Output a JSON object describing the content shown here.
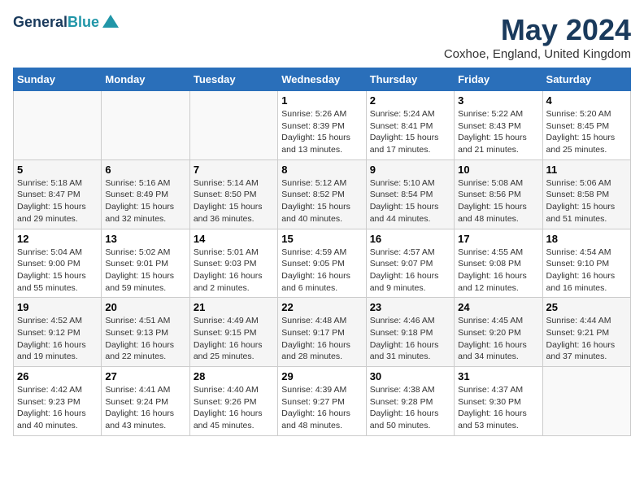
{
  "header": {
    "logo_line1": "General",
    "logo_line2": "Blue",
    "month": "May 2024",
    "location": "Coxhoe, England, United Kingdom"
  },
  "columns": [
    "Sunday",
    "Monday",
    "Tuesday",
    "Wednesday",
    "Thursday",
    "Friday",
    "Saturday"
  ],
  "weeks": [
    [
      {
        "day": "",
        "info": ""
      },
      {
        "day": "",
        "info": ""
      },
      {
        "day": "",
        "info": ""
      },
      {
        "day": "1",
        "info": "Sunrise: 5:26 AM\nSunset: 8:39 PM\nDaylight: 15 hours\nand 13 minutes."
      },
      {
        "day": "2",
        "info": "Sunrise: 5:24 AM\nSunset: 8:41 PM\nDaylight: 15 hours\nand 17 minutes."
      },
      {
        "day": "3",
        "info": "Sunrise: 5:22 AM\nSunset: 8:43 PM\nDaylight: 15 hours\nand 21 minutes."
      },
      {
        "day": "4",
        "info": "Sunrise: 5:20 AM\nSunset: 8:45 PM\nDaylight: 15 hours\nand 25 minutes."
      }
    ],
    [
      {
        "day": "5",
        "info": "Sunrise: 5:18 AM\nSunset: 8:47 PM\nDaylight: 15 hours\nand 29 minutes."
      },
      {
        "day": "6",
        "info": "Sunrise: 5:16 AM\nSunset: 8:49 PM\nDaylight: 15 hours\nand 32 minutes."
      },
      {
        "day": "7",
        "info": "Sunrise: 5:14 AM\nSunset: 8:50 PM\nDaylight: 15 hours\nand 36 minutes."
      },
      {
        "day": "8",
        "info": "Sunrise: 5:12 AM\nSunset: 8:52 PM\nDaylight: 15 hours\nand 40 minutes."
      },
      {
        "day": "9",
        "info": "Sunrise: 5:10 AM\nSunset: 8:54 PM\nDaylight: 15 hours\nand 44 minutes."
      },
      {
        "day": "10",
        "info": "Sunrise: 5:08 AM\nSunset: 8:56 PM\nDaylight: 15 hours\nand 48 minutes."
      },
      {
        "day": "11",
        "info": "Sunrise: 5:06 AM\nSunset: 8:58 PM\nDaylight: 15 hours\nand 51 minutes."
      }
    ],
    [
      {
        "day": "12",
        "info": "Sunrise: 5:04 AM\nSunset: 9:00 PM\nDaylight: 15 hours\nand 55 minutes."
      },
      {
        "day": "13",
        "info": "Sunrise: 5:02 AM\nSunset: 9:01 PM\nDaylight: 15 hours\nand 59 minutes."
      },
      {
        "day": "14",
        "info": "Sunrise: 5:01 AM\nSunset: 9:03 PM\nDaylight: 16 hours\nand 2 minutes."
      },
      {
        "day": "15",
        "info": "Sunrise: 4:59 AM\nSunset: 9:05 PM\nDaylight: 16 hours\nand 6 minutes."
      },
      {
        "day": "16",
        "info": "Sunrise: 4:57 AM\nSunset: 9:07 PM\nDaylight: 16 hours\nand 9 minutes."
      },
      {
        "day": "17",
        "info": "Sunrise: 4:55 AM\nSunset: 9:08 PM\nDaylight: 16 hours\nand 12 minutes."
      },
      {
        "day": "18",
        "info": "Sunrise: 4:54 AM\nSunset: 9:10 PM\nDaylight: 16 hours\nand 16 minutes."
      }
    ],
    [
      {
        "day": "19",
        "info": "Sunrise: 4:52 AM\nSunset: 9:12 PM\nDaylight: 16 hours\nand 19 minutes."
      },
      {
        "day": "20",
        "info": "Sunrise: 4:51 AM\nSunset: 9:13 PM\nDaylight: 16 hours\nand 22 minutes."
      },
      {
        "day": "21",
        "info": "Sunrise: 4:49 AM\nSunset: 9:15 PM\nDaylight: 16 hours\nand 25 minutes."
      },
      {
        "day": "22",
        "info": "Sunrise: 4:48 AM\nSunset: 9:17 PM\nDaylight: 16 hours\nand 28 minutes."
      },
      {
        "day": "23",
        "info": "Sunrise: 4:46 AM\nSunset: 9:18 PM\nDaylight: 16 hours\nand 31 minutes."
      },
      {
        "day": "24",
        "info": "Sunrise: 4:45 AM\nSunset: 9:20 PM\nDaylight: 16 hours\nand 34 minutes."
      },
      {
        "day": "25",
        "info": "Sunrise: 4:44 AM\nSunset: 9:21 PM\nDaylight: 16 hours\nand 37 minutes."
      }
    ],
    [
      {
        "day": "26",
        "info": "Sunrise: 4:42 AM\nSunset: 9:23 PM\nDaylight: 16 hours\nand 40 minutes."
      },
      {
        "day": "27",
        "info": "Sunrise: 4:41 AM\nSunset: 9:24 PM\nDaylight: 16 hours\nand 43 minutes."
      },
      {
        "day": "28",
        "info": "Sunrise: 4:40 AM\nSunset: 9:26 PM\nDaylight: 16 hours\nand 45 minutes."
      },
      {
        "day": "29",
        "info": "Sunrise: 4:39 AM\nSunset: 9:27 PM\nDaylight: 16 hours\nand 48 minutes."
      },
      {
        "day": "30",
        "info": "Sunrise: 4:38 AM\nSunset: 9:28 PM\nDaylight: 16 hours\nand 50 minutes."
      },
      {
        "day": "31",
        "info": "Sunrise: 4:37 AM\nSunset: 9:30 PM\nDaylight: 16 hours\nand 53 minutes."
      },
      {
        "day": "",
        "info": ""
      }
    ]
  ]
}
